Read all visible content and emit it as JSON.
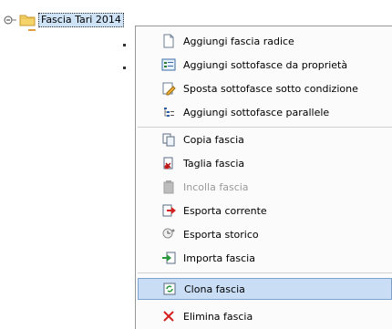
{
  "tree": {
    "node_label": "Fascia Tari 2014"
  },
  "menu": {
    "items": [
      {
        "label": "Aggiungi fascia radice",
        "icon": "new-document-icon",
        "disabled": false
      },
      {
        "label": "Aggiungi sottofasce da proprietà",
        "icon": "properties-list-icon",
        "disabled": false
      },
      {
        "label": "Sposta sottofasce sotto condizione",
        "icon": "edit-document-icon",
        "disabled": false
      },
      {
        "label": "Aggiungi sottofasce parallele",
        "icon": "tree-list-icon",
        "disabled": false
      },
      {
        "label": "Copia fascia",
        "icon": "copy-icon",
        "disabled": false
      },
      {
        "label": "Taglia fascia",
        "icon": "cut-icon",
        "disabled": false
      },
      {
        "label": "Incolla fascia",
        "icon": "paste-icon",
        "disabled": true
      },
      {
        "label": "Esporta corrente",
        "icon": "export-icon",
        "disabled": false
      },
      {
        "label": "Esporta storico",
        "icon": "history-icon",
        "disabled": false
      },
      {
        "label": "Importa fascia",
        "icon": "import-icon",
        "disabled": false
      },
      {
        "label": "Clona fascia",
        "icon": "clone-icon",
        "disabled": false,
        "selected": true
      },
      {
        "label": "Elimina fascia",
        "icon": "delete-icon",
        "disabled": false
      }
    ]
  },
  "colors": {
    "selection_bg": "#c9def5",
    "selection_border": "#7da2ce",
    "node_highlight": "#cfe3f7",
    "delete_red": "#d42020"
  }
}
